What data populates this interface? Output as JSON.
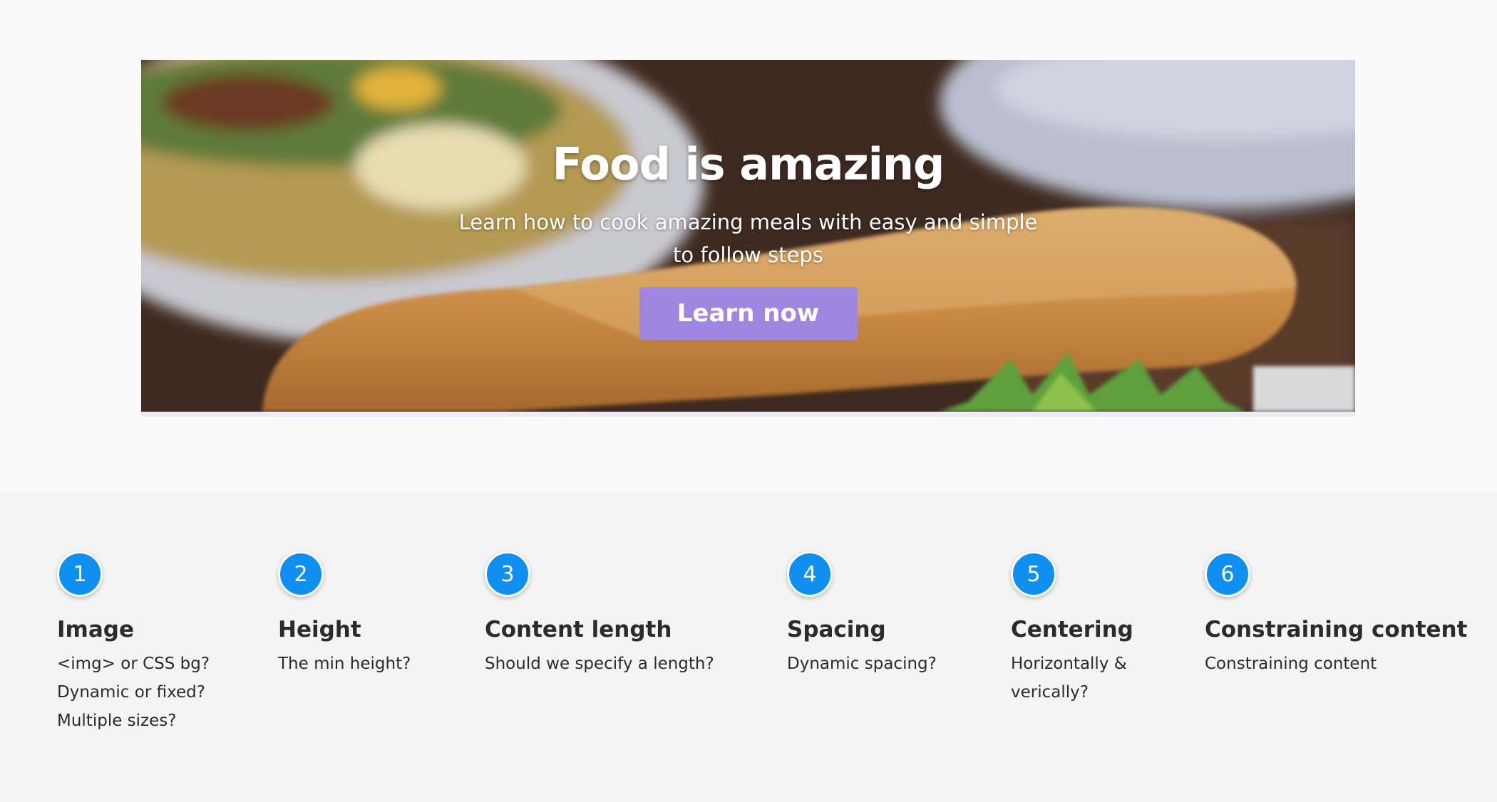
{
  "hero": {
    "title": "Food is amazing",
    "subtitle": "Learn how to cook amazing meals with easy and simple to follow steps",
    "button_label": "Learn now",
    "button_color": "#9f86e0"
  },
  "checklist": {
    "accent_color": "#0f8ff0",
    "items": [
      {
        "number": "1",
        "title": "Image",
        "lines": [
          "<img> or CSS bg?",
          "Dynamic or fixed?",
          "Multiple sizes?"
        ]
      },
      {
        "number": "2",
        "title": "Height",
        "lines": [
          "The min height?"
        ]
      },
      {
        "number": "3",
        "title": "Content length",
        "lines": [
          "Should we specify a length?"
        ]
      },
      {
        "number": "4",
        "title": "Spacing",
        "lines": [
          "Dynamic spacing?"
        ]
      },
      {
        "number": "5",
        "title": "Centering",
        "lines": [
          "Horizontally &",
          "verically?"
        ]
      },
      {
        "number": "6",
        "title": "Constraining content",
        "lines": [
          "Constraining content"
        ]
      }
    ]
  }
}
